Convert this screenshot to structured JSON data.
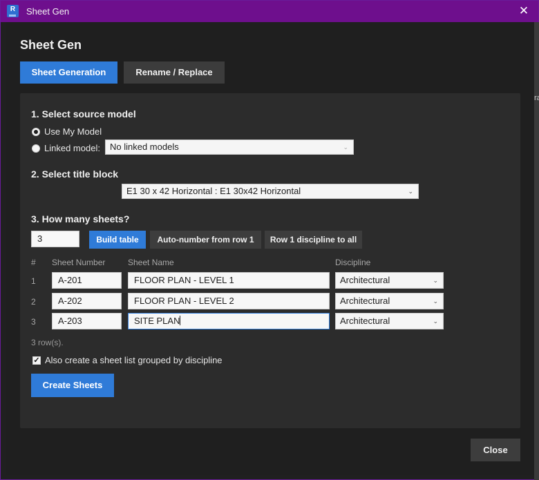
{
  "window": {
    "title": "Sheet Gen",
    "app_icon_letter": "R",
    "close_glyph": "✕",
    "accent_color": "#6e0f8d"
  },
  "edge": {
    "partial_text": "ra"
  },
  "header": {
    "title": "Sheet Gen"
  },
  "tabs": [
    {
      "label": "Sheet Generation",
      "active": true
    },
    {
      "label": "Rename / Replace",
      "active": false
    }
  ],
  "section1": {
    "title": "1.  Select source model",
    "option_my_model": "Use My Model",
    "option_linked": "Linked model:",
    "selected": "Use My Model",
    "linked_select_value": "No linked models"
  },
  "section2": {
    "title": "2.  Select title block",
    "title_block_value": "E1 30 x 42 Horizontal : E1 30x42 Horizontal"
  },
  "section3": {
    "title": "3.  How many sheets?",
    "count_value": "3",
    "build_table": "Build table",
    "auto_number": "Auto-number from row 1",
    "discipline_to_all": "Row 1 discipline to all"
  },
  "table": {
    "headers": {
      "num": "#",
      "sheet_number": "Sheet Number",
      "sheet_name": "Sheet Name",
      "discipline": "Discipline"
    },
    "rows": [
      {
        "num": "1",
        "sheet_number": "A-201",
        "sheet_name": "FLOOR PLAN - LEVEL 1",
        "discipline": "Architectural"
      },
      {
        "num": "2",
        "sheet_number": "A-202",
        "sheet_name": "FLOOR PLAN - LEVEL 2",
        "discipline": "Architectural"
      },
      {
        "num": "3",
        "sheet_number": "A-203",
        "sheet_name": "SITE PLAN",
        "discipline": "Architectural"
      }
    ],
    "row_count_text": "3 row(s)."
  },
  "options": {
    "sheet_list_label": "Also create a sheet list grouped by discipline",
    "sheet_list_checked": true
  },
  "actions": {
    "create": "Create Sheets",
    "close": "Close"
  },
  "colors": {
    "primary": "#2f7bd8",
    "panel": "#2c2c2c",
    "background": "#1f1f1f"
  },
  "icons": {
    "dropdown": "chevron-down-icon",
    "check": "checkmark-icon"
  }
}
